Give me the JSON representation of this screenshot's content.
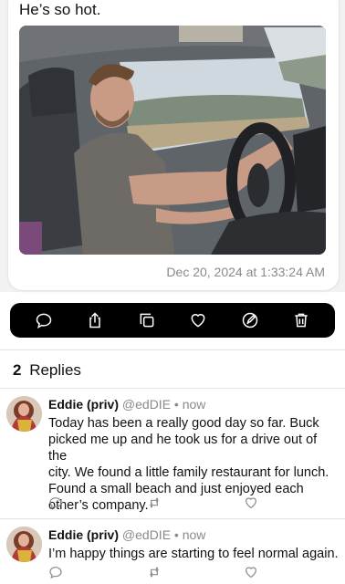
{
  "post": {
    "text": "He’s so hot.",
    "timestamp": "Dec 20, 2024 at 1:33:24 AM",
    "photo_description_icon": "photo-of-man-driving"
  },
  "action_bar": {
    "icons": [
      "speech-bubble-icon",
      "share-icon",
      "copy-icon",
      "heart-icon",
      "edit-icon",
      "trash-icon"
    ]
  },
  "replies": {
    "count": "2",
    "label": "Replies",
    "items": [
      {
        "name": "Eddie (priv)",
        "handle": "@edDIE",
        "separator": "•",
        "time": "now",
        "lines": [
          "Today has been a really good day so far. Buck",
          "picked me up and he took us for a drive out of the",
          "city. We found a little family restaurant for lunch.",
          "Found a small beach and just enjoyed each",
          "other’s company."
        ]
      },
      {
        "name": "Eddie (priv)",
        "handle": "@edDIE",
        "separator": "•",
        "time": "now",
        "lines": [
          "I’m happy things are starting to feel normal again."
        ]
      }
    ]
  },
  "colors": {
    "action_bar_bg": "#000000",
    "secondary_text": "#8a8a8e"
  }
}
